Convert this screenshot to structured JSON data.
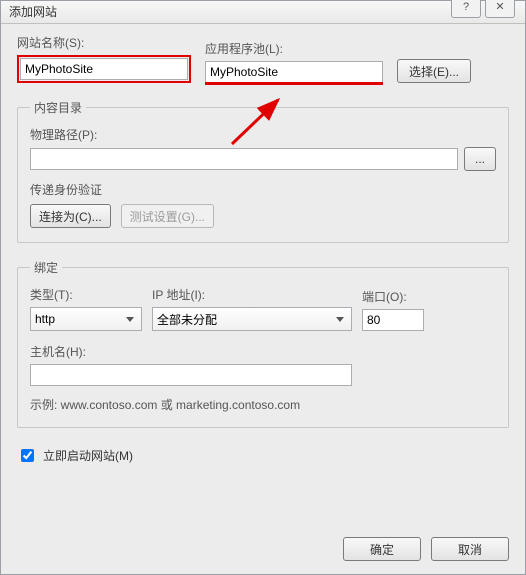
{
  "window": {
    "title": "添加网站",
    "help_btn": "?",
    "close_btn": "✕"
  },
  "site_name": {
    "label": "网站名称(S):",
    "value": "MyPhotoSite"
  },
  "app_pool": {
    "label": "应用程序池(L):",
    "value": "MyPhotoSite",
    "select_btn": "选择(E)..."
  },
  "content": {
    "legend": "内容目录",
    "phys_path_label": "物理路径(P):",
    "phys_path_value": "",
    "browse_btn": "...",
    "passthrough_label": "传递身份验证",
    "connect_as_btn": "连接为(C)...",
    "test_settings_btn": "测试设置(G)..."
  },
  "binding": {
    "legend": "绑定",
    "type_label": "类型(T):",
    "type_value": "http",
    "ip_label": "IP 地址(I):",
    "ip_value": "全部未分配",
    "port_label": "端口(O):",
    "port_value": "80",
    "host_label": "主机名(H):",
    "host_value": "",
    "example": "示例: www.contoso.com 或 marketing.contoso.com"
  },
  "start_site": {
    "label": "立即启动网站(M)",
    "checked": true
  },
  "footer": {
    "ok": "确定",
    "cancel": "取消"
  }
}
